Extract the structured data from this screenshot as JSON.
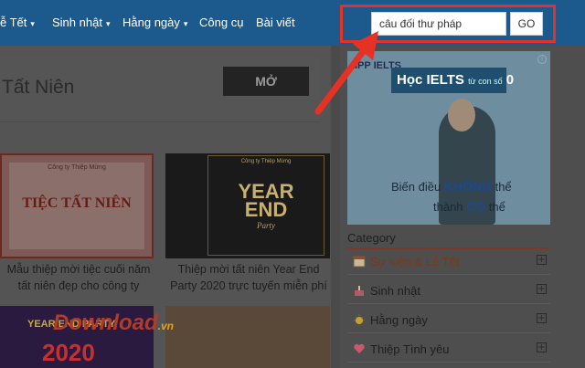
{
  "nav": {
    "items": [
      {
        "label": "ễ Tết",
        "caret": "▾"
      },
      {
        "label": "Sinh nhật",
        "caret": "▾"
      },
      {
        "label": "Hằng ngày",
        "caret": "▾"
      },
      {
        "label": "Công cụ",
        "caret": ""
      },
      {
        "label": "Bài viết",
        "caret": ""
      }
    ]
  },
  "search": {
    "value": "câu đối thư pháp",
    "go_label": "GO",
    "highlight_color": "#e63225"
  },
  "main": {
    "title": "Tất Niên",
    "open_button_label": "MỞ",
    "cards": [
      {
        "image_company": "Công ty Thiệp Mừng",
        "image_headline": "TIỆC TẤT NIÊN",
        "caption": "Mẫu thiệp mời tiệc cuối năm tất niên đẹp cho công ty"
      },
      {
        "image_company": "Công ty Thiệp Mừng",
        "image_year": "YEAR",
        "image_end": "END",
        "image_party": "Party",
        "caption": "Thiệp mời tất niên Year End Party 2020 trực tuyến miễn phí"
      },
      {
        "image_text": "YEAR END PARTY",
        "image_year": "2020"
      },
      {}
    ],
    "watermark": "Download",
    "watermark_tld": ".vn"
  },
  "ad": {
    "logo": "IPP IELTS",
    "title": "Học IELTS",
    "title_small": "từ con số",
    "title_number": "0",
    "slogan1_pre": "Biến điều",
    "slogan1_bold": "KHÔNG",
    "slogan1_post": "thể",
    "slogan2_pre": "thành",
    "slogan2_bold": "CÓ",
    "slogan2_post": "thể"
  },
  "sidebar": {
    "category_heading": "Category",
    "items": [
      {
        "label": "Sự kiện & Lễ Tết",
        "icon": "calendar-icon",
        "expand": "+"
      },
      {
        "label": "Sinh nhật",
        "icon": "cake-icon",
        "expand": "+"
      },
      {
        "label": "Hằng ngày",
        "icon": "sun-icon",
        "expand": "+"
      },
      {
        "label": "Thiệp Tình yêu",
        "icon": "heart-icon",
        "expand": "+"
      }
    ]
  }
}
